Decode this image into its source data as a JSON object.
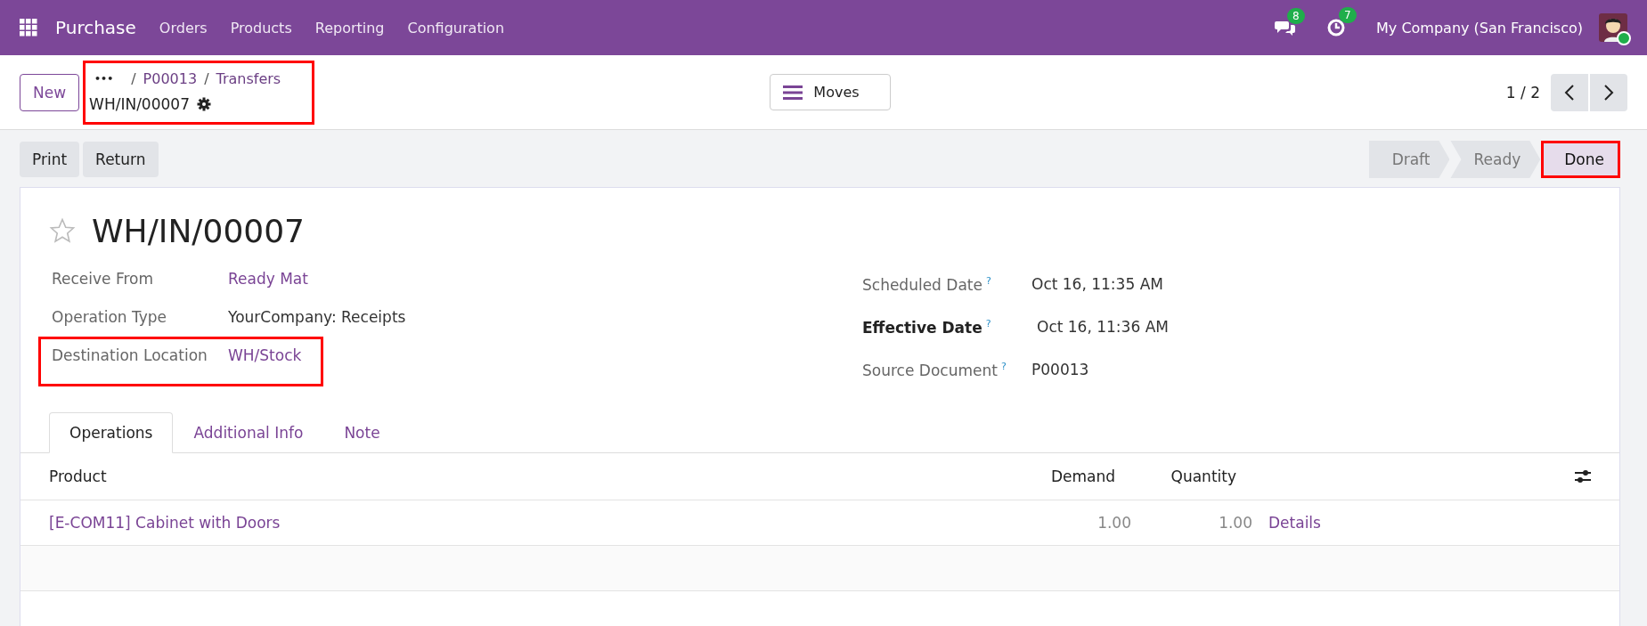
{
  "navbar": {
    "app_name": "Purchase",
    "menu": [
      "Orders",
      "Products",
      "Reporting",
      "Configuration"
    ],
    "messages_count": "8",
    "activities_count": "7",
    "company": "My Company (San Francisco)",
    "user_online": true
  },
  "control_panel": {
    "new_button": "New",
    "breadcrumb": {
      "highlighted": true,
      "ellipsis": "•••",
      "items": [
        {
          "separator": "/",
          "label": "P00013"
        },
        {
          "separator": "/",
          "label": "Transfers"
        }
      ],
      "current": "WH/IN/00007"
    },
    "view_button": "Moves",
    "pager": "1 / 2"
  },
  "action_buttons": [
    "Print",
    "Return"
  ],
  "status_stages": [
    {
      "label": "Draft",
      "selected": false,
      "highlighted": false
    },
    {
      "label": "Ready",
      "selected": false,
      "highlighted": false
    },
    {
      "label": "Done",
      "selected": true,
      "highlighted": true
    }
  ],
  "record": {
    "starred": false,
    "title": "WH/IN/00007"
  },
  "left_fields": [
    {
      "label": "Receive From",
      "value": "Ready Mat",
      "kind": "link",
      "highlighted": false
    },
    {
      "label": "Operation Type",
      "value": "YourCompany: Receipts",
      "kind": "text",
      "highlighted": false
    },
    {
      "label": "Destination Location",
      "value": "WH/Stock",
      "kind": "link",
      "highlighted": true
    }
  ],
  "right_fields": [
    {
      "label": "Scheduled Date",
      "help": "?",
      "value": "Oct 16, 11:35 AM",
      "bold": false
    },
    {
      "label": "Effective Date",
      "help": "?",
      "value": "Oct 16, 11:36 AM",
      "bold": true
    },
    {
      "label": "Source Document",
      "help": "?",
      "value": "P00013",
      "bold": false
    }
  ],
  "tabs": [
    {
      "label": "Operations",
      "selected": true
    },
    {
      "label": "Additional Info",
      "selected": false
    },
    {
      "label": "Note",
      "selected": false
    }
  ],
  "table": {
    "columns": [
      "Product",
      "Demand",
      "Quantity"
    ],
    "rows": [
      {
        "product": "[E-COM11] Cabinet with Doors",
        "demand": "1.00",
        "quantity": "1.00",
        "action": "Details"
      }
    ]
  }
}
